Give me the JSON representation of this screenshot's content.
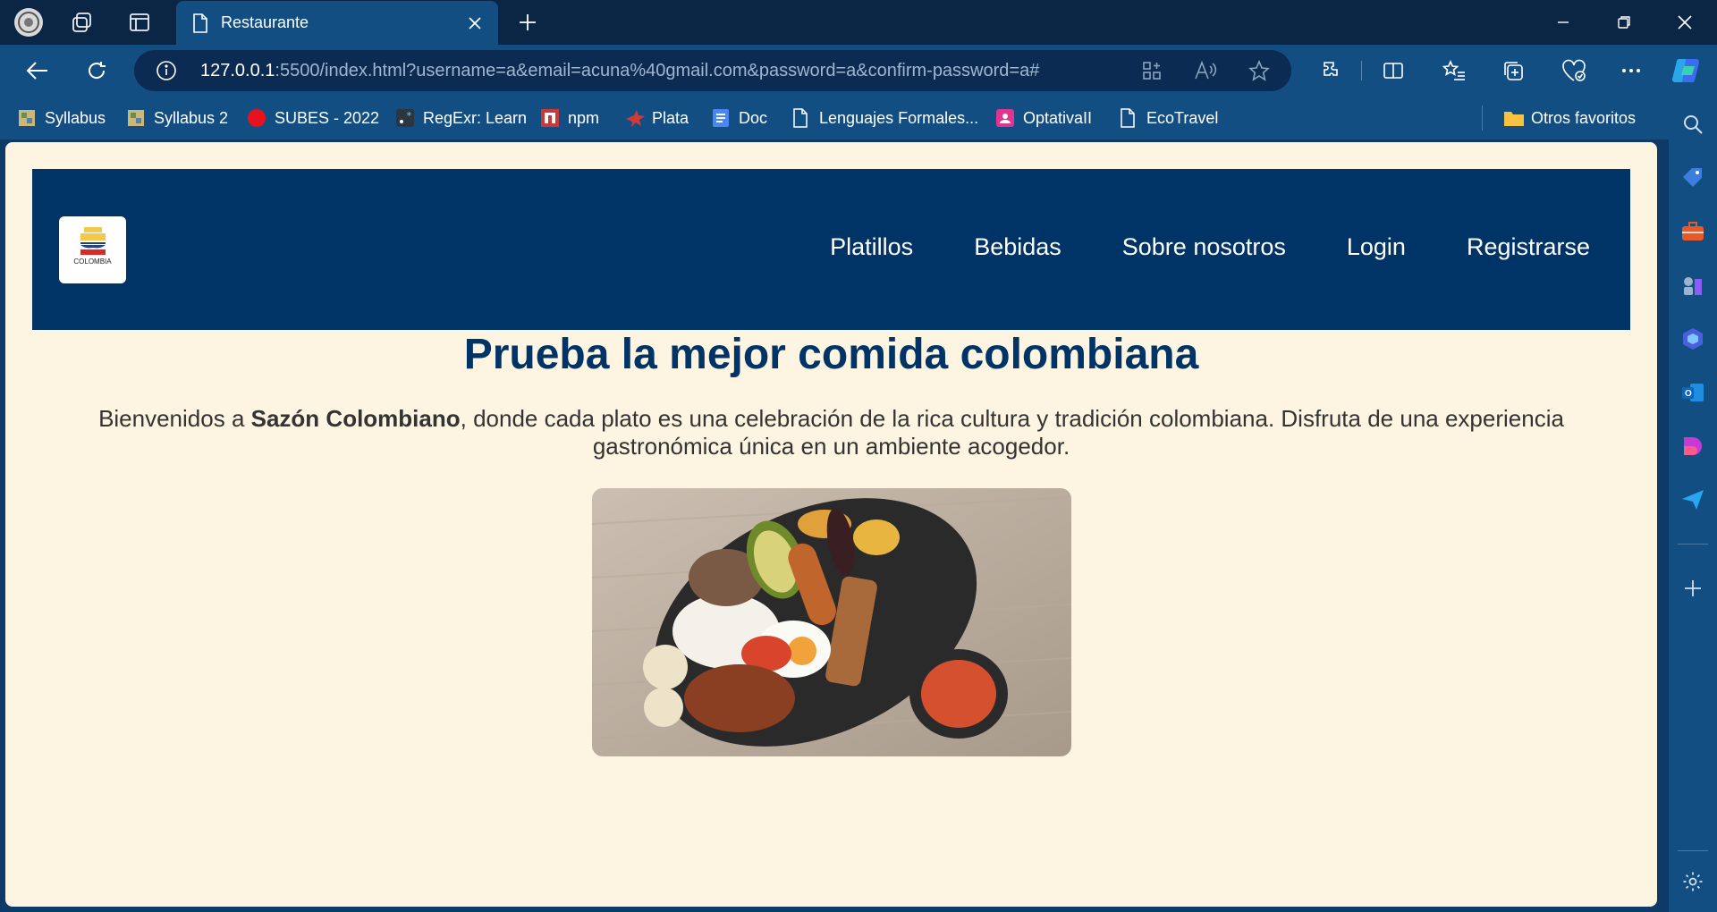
{
  "browser": {
    "tab_title": "Restaurante",
    "url_host": "127.0.0.1",
    "url_rest": ":5500/index.html?username=a&email=acuna%40gmail.com&password=a&confirm-password=a#",
    "accent_color": "#134e82",
    "titlebar_color": "#0b2545"
  },
  "bookmarks": [
    {
      "label": "Syllabus",
      "icon": "syllabus-icon"
    },
    {
      "label": "Syllabus 2",
      "icon": "syllabus-icon"
    },
    {
      "label": "SUBES - 2022",
      "icon": "red-circle-icon"
    },
    {
      "label": "RegExr: Learn",
      "icon": "regexr-icon"
    },
    {
      "label": "npm",
      "icon": "npm-icon"
    },
    {
      "label": "Plata",
      "icon": "plata-icon"
    },
    {
      "label": "Doc",
      "icon": "doc-icon"
    },
    {
      "label": "Lenguajes Formales...",
      "icon": "page-icon"
    },
    {
      "label": "OptativaII",
      "icon": "contact-icon"
    },
    {
      "label": "EcoTravel",
      "icon": "page-icon"
    }
  ],
  "other_favorites": "Otros favoritos",
  "site": {
    "logo_text": "COLOMBIA",
    "nav": [
      "Platillos",
      "Bebidas",
      "Sobre nosotros",
      "Login",
      "Registrarse"
    ],
    "hero_title": "Prueba la mejor comida colombiana",
    "intro_prefix": "Bienvenidos a ",
    "intro_brand": "Sazón Colombiano",
    "intro_suffix": ", donde cada plato es una celebración de la rica cultura y tradición colombiana. Disfruta de una experiencia gastronómica única en un ambiente acogedor.",
    "header_color": "#003366",
    "page_bg": "#fdf5e1",
    "image_alt": "bandeja-paisa-photo"
  }
}
